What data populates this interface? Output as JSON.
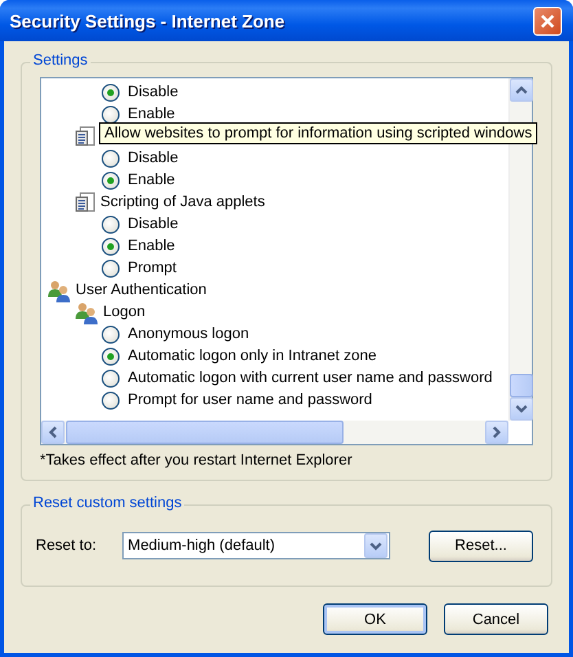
{
  "window": {
    "title": "Security Settings - Internet Zone"
  },
  "settings_group": {
    "legend": "Settings",
    "tree": [
      {
        "kind": "category",
        "children": [
          {
            "kind": "setting",
            "children": [
              {
                "kind": "radio",
                "label": "Disable",
                "selected": true
              },
              {
                "kind": "radio",
                "label": "Enable",
                "selected": false
              }
            ]
          },
          {
            "kind": "script_setting",
            "children": [
              {
                "kind": "radio",
                "label": "Disable",
                "selected": false
              },
              {
                "kind": "radio",
                "label": "Enable",
                "selected": true
              }
            ]
          },
          {
            "kind": "script_setting",
            "label": "Scripting of Java applets",
            "children": [
              {
                "kind": "radio",
                "label": "Disable",
                "selected": false
              },
              {
                "kind": "radio",
                "label": "Enable",
                "selected": true
              },
              {
                "kind": "radio",
                "label": "Prompt",
                "selected": false
              }
            ]
          }
        ]
      },
      {
        "kind": "auth_category",
        "label": "User Authentication",
        "children": [
          {
            "kind": "auth_setting",
            "label": "Logon",
            "children": [
              {
                "kind": "radio",
                "label": "Anonymous logon",
                "selected": false
              },
              {
                "kind": "radio",
                "label": "Automatic logon only in Intranet zone",
                "selected": true
              },
              {
                "kind": "radio",
                "label": "Automatic logon with current user name and password",
                "selected": false
              },
              {
                "kind": "radio",
                "label": "Prompt for user name and password",
                "selected": false
              }
            ]
          }
        ]
      }
    ],
    "tooltip": "Allow websites to prompt for information using scripted windows",
    "note": "*Takes effect after you restart Internet Explorer"
  },
  "reset_group": {
    "legend": "Reset custom settings",
    "label": "Reset to:",
    "dropdown": {
      "value": "Medium-high (default)"
    },
    "button": "Reset..."
  },
  "buttons": [
    "OK",
    "Cancel"
  ]
}
